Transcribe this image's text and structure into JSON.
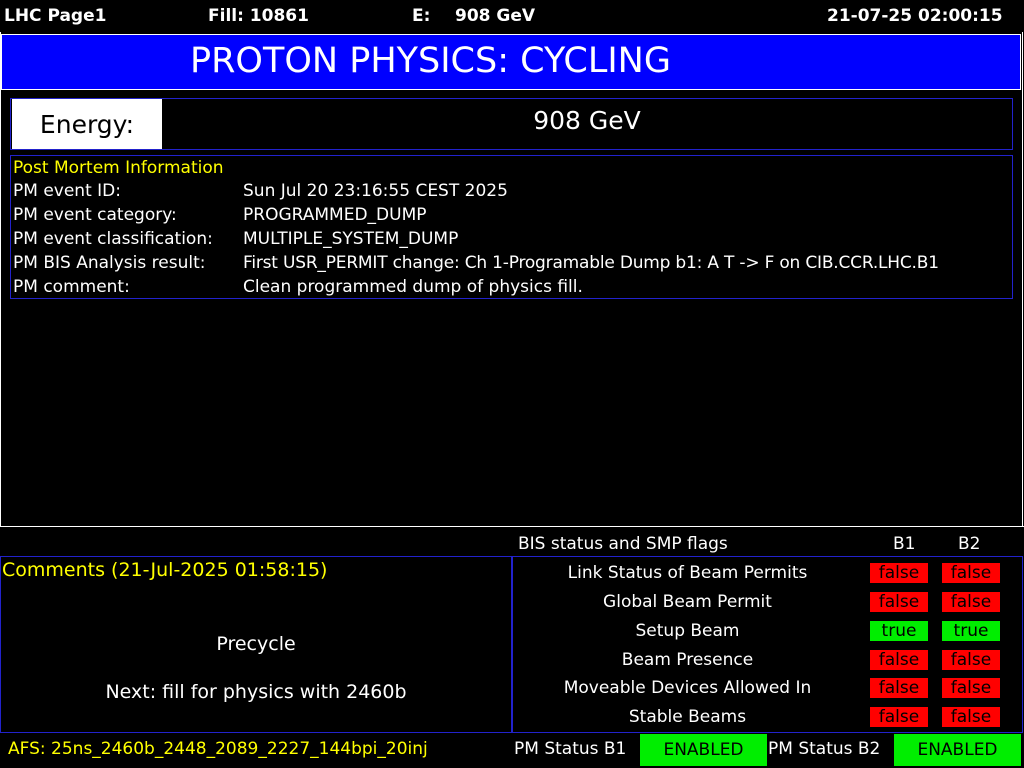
{
  "header": {
    "page": "LHC Page1",
    "fill": "Fill: 10861",
    "energy_label": "E:",
    "energy_value": "908 GeV",
    "datetime": "21-07-25 02:00:15"
  },
  "banner": {
    "mode": "PROTON PHYSICS: CYCLING"
  },
  "energy": {
    "label": "Energy:",
    "value": "908 GeV"
  },
  "post_mortem": {
    "title": "Post Mortem Information",
    "rows": [
      {
        "label": "PM event ID:",
        "value": "Sun Jul 20 23:16:55 CEST 2025"
      },
      {
        "label": "PM event category:",
        "value": "PROGRAMMED_DUMP"
      },
      {
        "label": "PM event classification:",
        "value": "MULTIPLE_SYSTEM_DUMP"
      },
      {
        "label": "PM BIS Analysis result:",
        "value": "First USR_PERMIT change: Ch 1-Programable Dump b1: A T -> F on CIB.CCR.LHC.B1"
      },
      {
        "label": "PM comment:",
        "value": "Clean programmed dump of physics fill."
      }
    ]
  },
  "bis": {
    "title": "BIS status and SMP flags",
    "col_b1": "B1",
    "col_b2": "B2",
    "flags": [
      {
        "label": "Link Status of Beam Permits",
        "b1": "false",
        "b2": "false"
      },
      {
        "label": "Global Beam Permit",
        "b1": "false",
        "b2": "false"
      },
      {
        "label": "Setup Beam",
        "b1": "true",
        "b2": "true"
      },
      {
        "label": "Beam Presence",
        "b1": "false",
        "b2": "false"
      },
      {
        "label": "Moveable Devices Allowed In",
        "b1": "false",
        "b2": "false"
      },
      {
        "label": "Stable Beams",
        "b1": "false",
        "b2": "false"
      }
    ]
  },
  "comments": {
    "title": "Comments (21-Jul-2025 01:58:15)",
    "line1": "Precycle",
    "line2": "Next: fill for physics with 2460b"
  },
  "footer": {
    "afs": "AFS: 25ns_2460b_2448_2089_2227_144bpi_20inj",
    "pm_b1_label": "PM Status B1",
    "pm_b1_value": "ENABLED",
    "pm_b2_label": "PM Status B2",
    "pm_b2_value": "ENABLED"
  },
  "colors": {
    "banner_blue": "#0000ff",
    "flag_false": "#ff0000",
    "flag_true": "#00ee00",
    "comment_title": "#ffff00"
  }
}
